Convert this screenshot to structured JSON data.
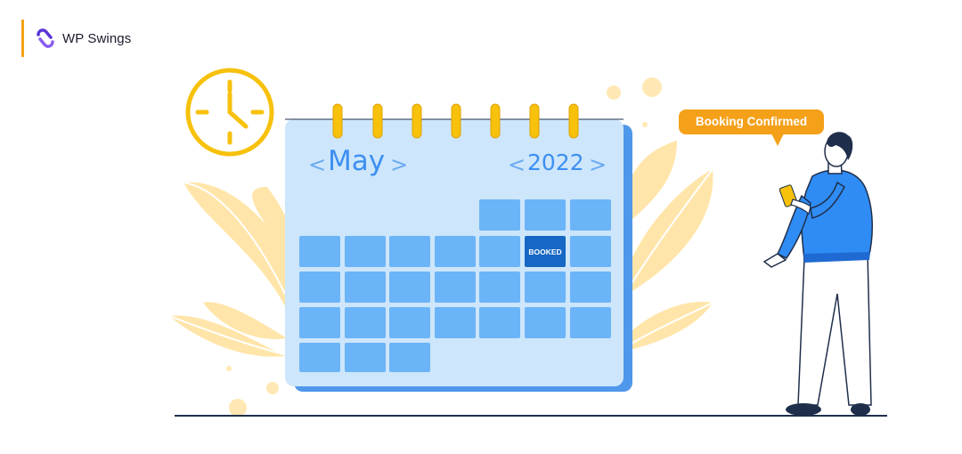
{
  "brand": {
    "name": "WP Swings",
    "logo_icon": "wp-swings-s-mark-icon",
    "accent_color": "#f3a316",
    "logo_color": "#5b35d5"
  },
  "calendar": {
    "month": "May",
    "year": "2022",
    "prev_arrow": "<",
    "next_arrow": ">",
    "booked_label": "BOOKED",
    "booked_color": "#1668c4",
    "day_color": "#6bb4f7",
    "body_color": "#cde6fb"
  },
  "notification": {
    "text": "Booking Confirmed",
    "color": "#f5a019"
  },
  "decor": {
    "clock_icon": "clock-icon",
    "leaf_color": "#ffe5a9",
    "person": "person-holding-phone"
  }
}
